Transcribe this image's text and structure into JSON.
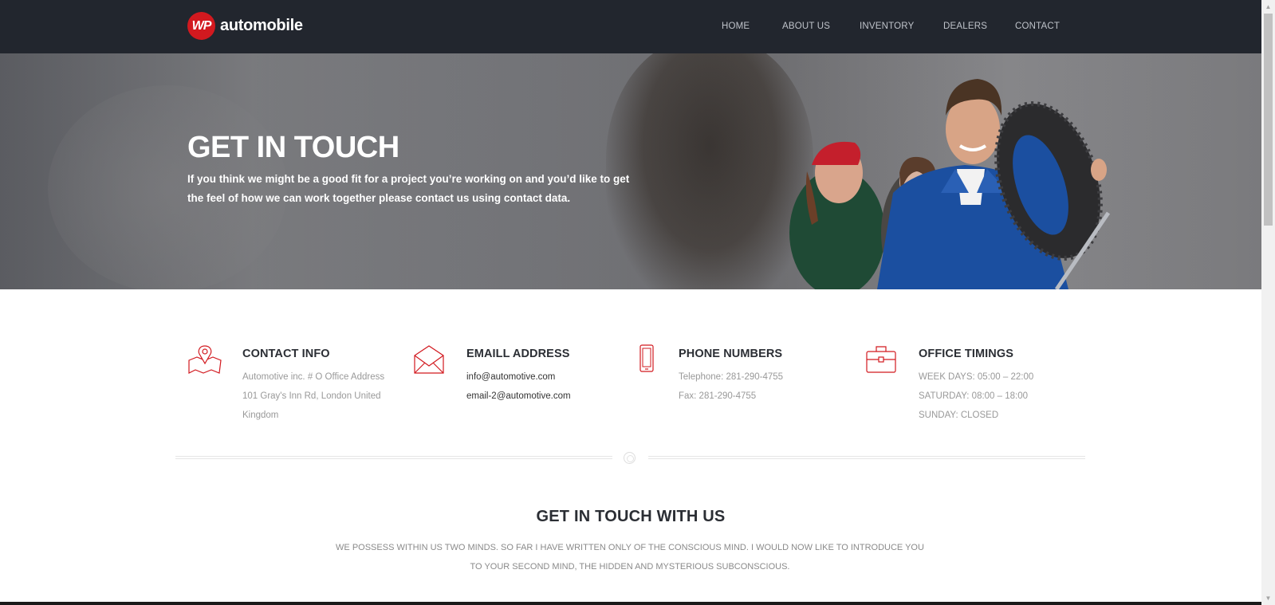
{
  "brand": {
    "badge": "WP",
    "name": "automobile",
    "accent": "#d2191f"
  },
  "nav": {
    "items": [
      {
        "label": "HOME"
      },
      {
        "label": "ABOUT US"
      },
      {
        "label": "INVENTORY"
      },
      {
        "label": "DEALERS"
      },
      {
        "label": "CONTACT"
      }
    ]
  },
  "hero": {
    "title": "GET IN TOUCH",
    "text": "If you think we might be a good fit for a project you’re working on and you’d like to get the feel of how we can work together please contact us using contact data."
  },
  "info": [
    {
      "icon": "map-pin-icon",
      "title": "CONTACT INFO",
      "lines": [
        "Automotive inc. # O Office Address",
        "101 Gray's Inn Rd, London United",
        "Kingdom"
      ]
    },
    {
      "icon": "envelope-icon",
      "title": "EMAILL ADDRESS",
      "lines": [
        "info@automotive.com",
        "email-2@automotive.com"
      ]
    },
    {
      "icon": "phone-icon",
      "title": "PHONE NUMBERS",
      "lines": [
        "Telephone: 281-290-4755",
        "Fax: 281-290-4755"
      ]
    },
    {
      "icon": "briefcase-icon",
      "title": "OFFICE TIMINGS",
      "lines": [
        "WEEK DAYS: 05:00 – 22:00",
        "SATURDAY: 08:00 – 18:00",
        "SUNDAY: CLOSED"
      ]
    }
  ],
  "section": {
    "title": "GET IN TOUCH WITH US",
    "text": "WE POSSESS WITHIN US TWO MINDS. SO FAR I HAVE WRITTEN ONLY OF THE CONSCIOUS MIND. I WOULD NOW LIKE TO INTRODUCE YOU TO YOUR SECOND MIND, THE HIDDEN AND MYSTERIOUS SUBCONSCIOUS."
  }
}
